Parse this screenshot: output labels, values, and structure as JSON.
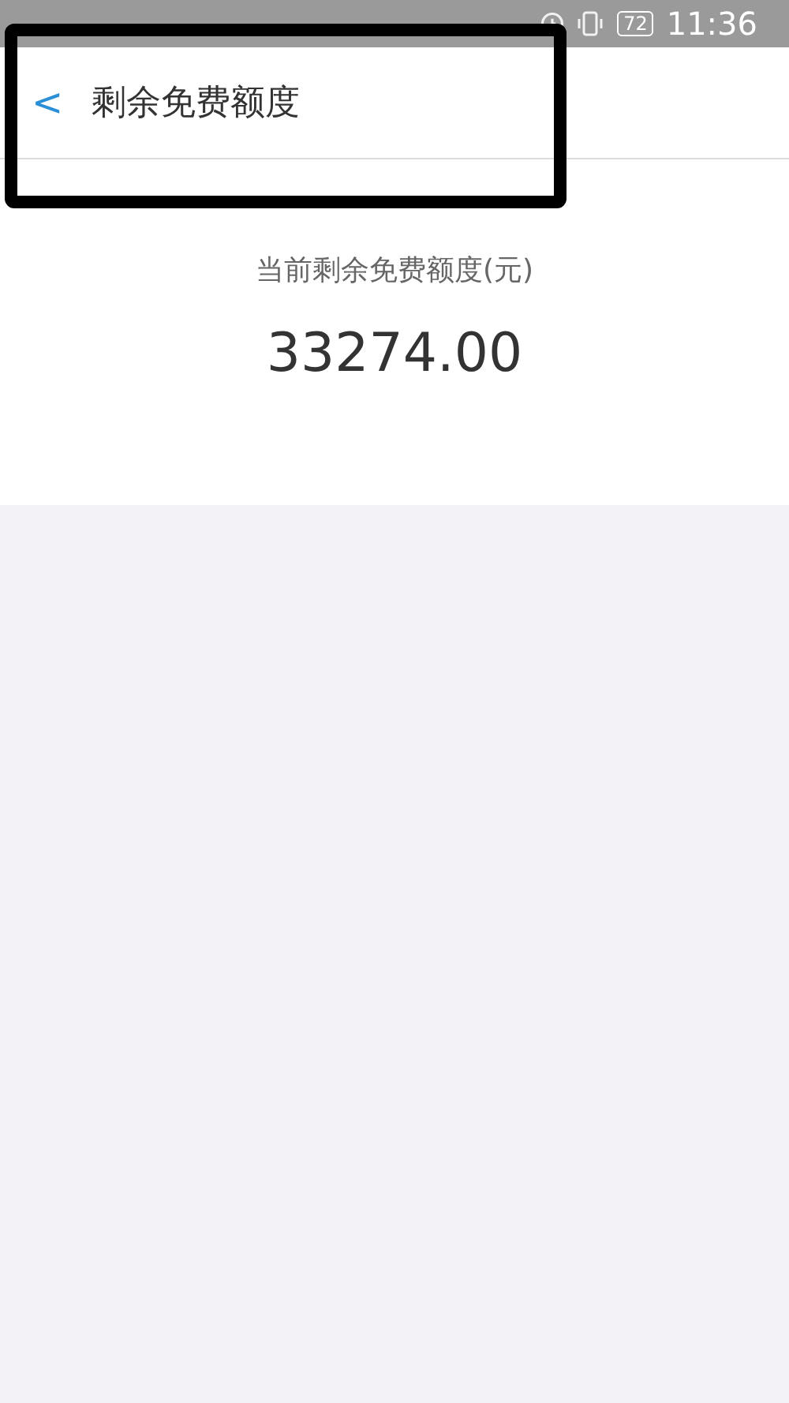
{
  "status_bar": {
    "battery": "72",
    "time": "11:36"
  },
  "header": {
    "back": "<",
    "title": "剩余免费额度"
  },
  "quota": {
    "label": "当前剩余免费额度(元)",
    "amount": "33274.00"
  }
}
